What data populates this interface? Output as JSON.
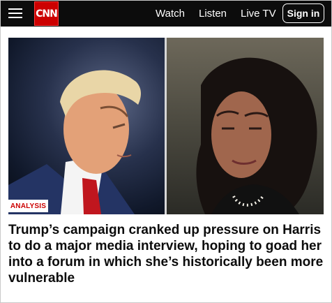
{
  "header": {
    "logo_text": "CNN",
    "nav": [
      {
        "label": "Watch"
      },
      {
        "label": "Listen"
      },
      {
        "label": "Live TV"
      }
    ],
    "sign_in_label": "Sign in"
  },
  "article": {
    "tag": "ANALYSIS",
    "headline": "Trump’s campaign cranked up pressure on Harris to do a major media interview, hoping to goad her into a forum in which she’s historically been more vulnerable"
  },
  "colors": {
    "brand_red": "#cc0000",
    "header_bg": "#0c0c0c",
    "headline_text": "#0c0c0c"
  },
  "icons": {
    "menu": "menu-icon"
  }
}
